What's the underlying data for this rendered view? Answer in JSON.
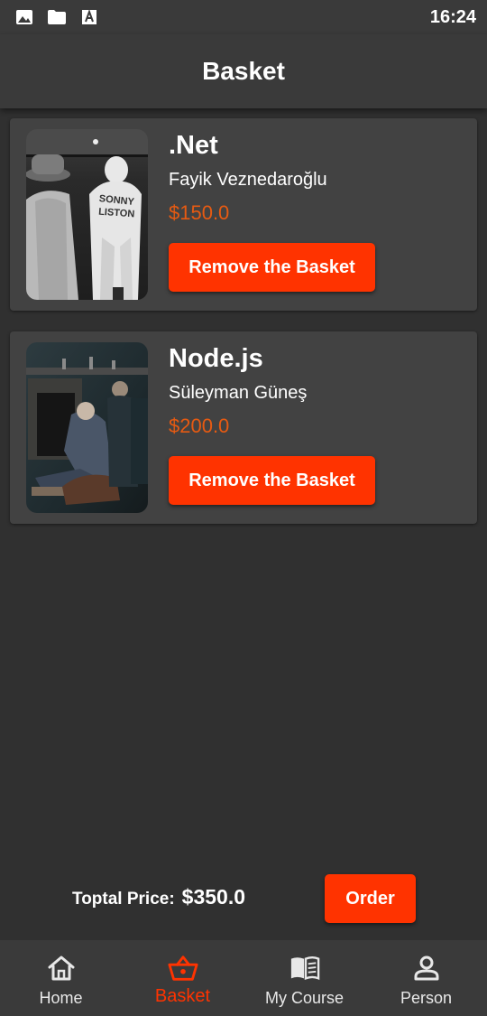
{
  "status_bar": {
    "time": "16:24",
    "icons": [
      "image-icon",
      "folder-icon",
      "font-icon"
    ]
  },
  "app_bar": {
    "title": "Basket"
  },
  "basket": {
    "items": [
      {
        "title": ".Net",
        "author": "Fayik Veznedaroğlu",
        "price": "$150.0",
        "button_label": "Remove the Basket"
      },
      {
        "title": "Node.js",
        "author": "Süleyman Güneş",
        "price": "$200.0",
        "button_label": "Remove the Basket"
      }
    ]
  },
  "summary": {
    "total_label": "Toptal Price:",
    "total_value": "$350.0",
    "order_label": "Order"
  },
  "bottom_nav": {
    "items": [
      {
        "label": "Home",
        "icon": "home-icon",
        "active": false
      },
      {
        "label": "Basket",
        "icon": "basket-icon",
        "active": true
      },
      {
        "label": "My Course",
        "icon": "book-icon",
        "active": false
      },
      {
        "label": "Person",
        "icon": "person-icon",
        "active": false
      }
    ]
  },
  "colors": {
    "accent": "#ff3300",
    "price": "#e65a12",
    "background": "#303030",
    "surface": "#424242",
    "bar": "#3a3a3a"
  }
}
